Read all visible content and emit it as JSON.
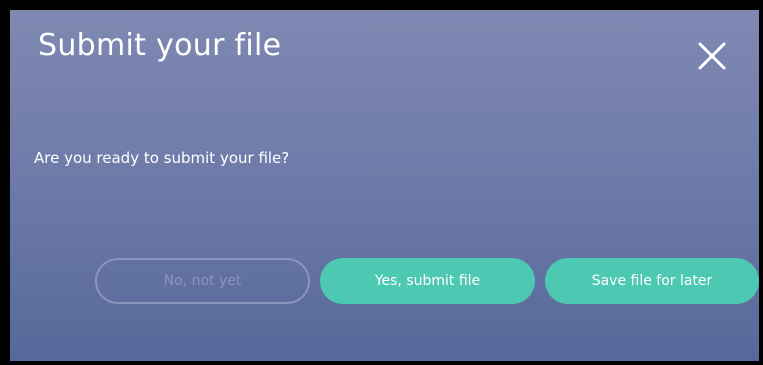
{
  "dialog": {
    "title": "Submit your file",
    "close_icon": "close-icon",
    "message": "Are you ready to submit your file?",
    "buttons": {
      "no_label": "No, not yet",
      "yes_label": "Yes, submit file",
      "later_label": "Save file for later"
    },
    "colors": {
      "background_top": "#7f89b2",
      "background_bottom": "#56689a",
      "primary_button": "#4dc8b2",
      "secondary_button_outline": "#8a94bd",
      "text": "#ffffff"
    }
  }
}
